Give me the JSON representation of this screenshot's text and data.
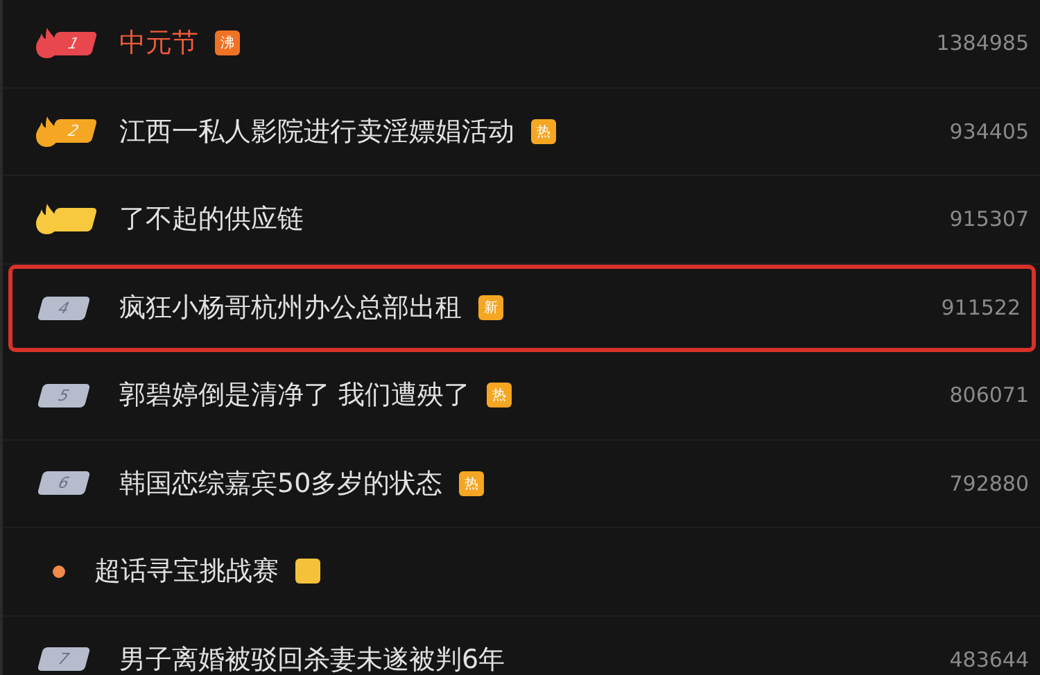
{
  "rows": [
    {
      "kind": "hot",
      "rank": "1",
      "color": "#e8474d",
      "title": "中元节",
      "emphasis": true,
      "tag": {
        "text": "沸",
        "color": "#f07224"
      },
      "count": "1384985",
      "selected": false
    },
    {
      "kind": "hot",
      "rank": "2",
      "color": "#f5a623",
      "title": "江西一私人影院进行卖淫嫖娼活动",
      "emphasis": false,
      "tag": {
        "text": "热",
        "color": "#f5a623"
      },
      "count": "934405",
      "selected": false
    },
    {
      "kind": "hot",
      "color": "#f8c83e",
      "title": "了不起的供应链",
      "emphasis": false,
      "count": "915307",
      "selected": false
    },
    {
      "kind": "normal",
      "rank": "4",
      "title": "疯狂小杨哥杭州办公总部出租",
      "emphasis": false,
      "tag": {
        "text": "新",
        "color": "#f5a623"
      },
      "count": "911522",
      "selected": true
    },
    {
      "kind": "normal",
      "rank": "5",
      "title": "郭碧婷倒是清净了 我们遭殃了",
      "emphasis": false,
      "tag": {
        "text": "热",
        "color": "#f5a623"
      },
      "count": "806071",
      "selected": false
    },
    {
      "kind": "normal",
      "rank": "6",
      "title": "韩国恋综嘉宾50多岁的状态",
      "emphasis": false,
      "tag": {
        "text": "热",
        "color": "#f5a623"
      },
      "count": "792880",
      "selected": false
    },
    {
      "kind": "promo",
      "color": "#f08a4b",
      "title": "超话寻宝挑战赛",
      "emphasis": false,
      "tag": {
        "color": "#f5c13a"
      },
      "selected": false
    },
    {
      "kind": "normal",
      "rank": "7",
      "title": "男子离婚被驳回杀妻未遂被判6年",
      "emphasis": false,
      "count": "483644",
      "selected": false
    }
  ]
}
